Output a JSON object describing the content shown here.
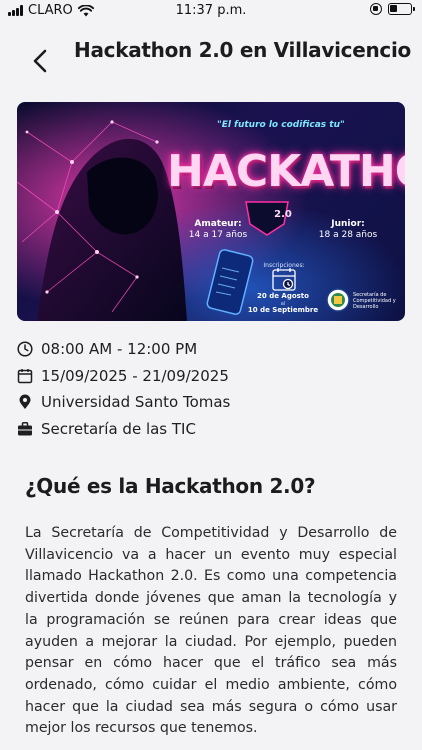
{
  "status_bar": {
    "carrier": "CLARO",
    "time": "11:37 p.m."
  },
  "header": {
    "title": "Hackathon 2.0 en Villavicencio"
  },
  "banner": {
    "tagline": "\"El futuro lo codificas tu\"",
    "headline": "HACKATHON",
    "version": "2.0",
    "amateur_title": "Amateur:",
    "amateur_ages": "14 a 17 años",
    "junior_title": "Junior:",
    "junior_ages": "18 a 28 años",
    "inscriptions_label": "Inscripciones:",
    "date_start": "20 de Agosto",
    "date_connector": "al",
    "date_end": "10 de Septiembre",
    "organizer": "Secretaría de Competitividad y Desarrollo"
  },
  "event_info": {
    "time_range": "08:00 AM - 12:00 PM",
    "date_range": "15/09/2025 - 21/09/2025",
    "location": "Universidad Santo Tomas",
    "organizer": "Secretaría de las TIC"
  },
  "section": {
    "title": "¿Qué es la Hackathon 2.0?",
    "body": "La Secretaría de Competitividad y Desarrollo de Villavicencio va a hacer un evento muy especial llamado Hackathon 2.0. Es como una competencia divertida donde jóvenes que aman la tecnología y la programación se reúnen para crear ideas que ayuden a mejorar la ciudad. Por ejemplo, pueden pensar en cómo hacer que el tráfico sea más ordenado, cómo cuidar el medio ambiente, cómo hacer que la ciudad sea más segura o cómo usar mejor los recursos que tenemos."
  },
  "colors": {
    "background": "#f3f2f5",
    "banner_dark": "#0b0c2e",
    "neon_pink": "#ff2fa3",
    "neon_cyan": "#7de6ff"
  }
}
